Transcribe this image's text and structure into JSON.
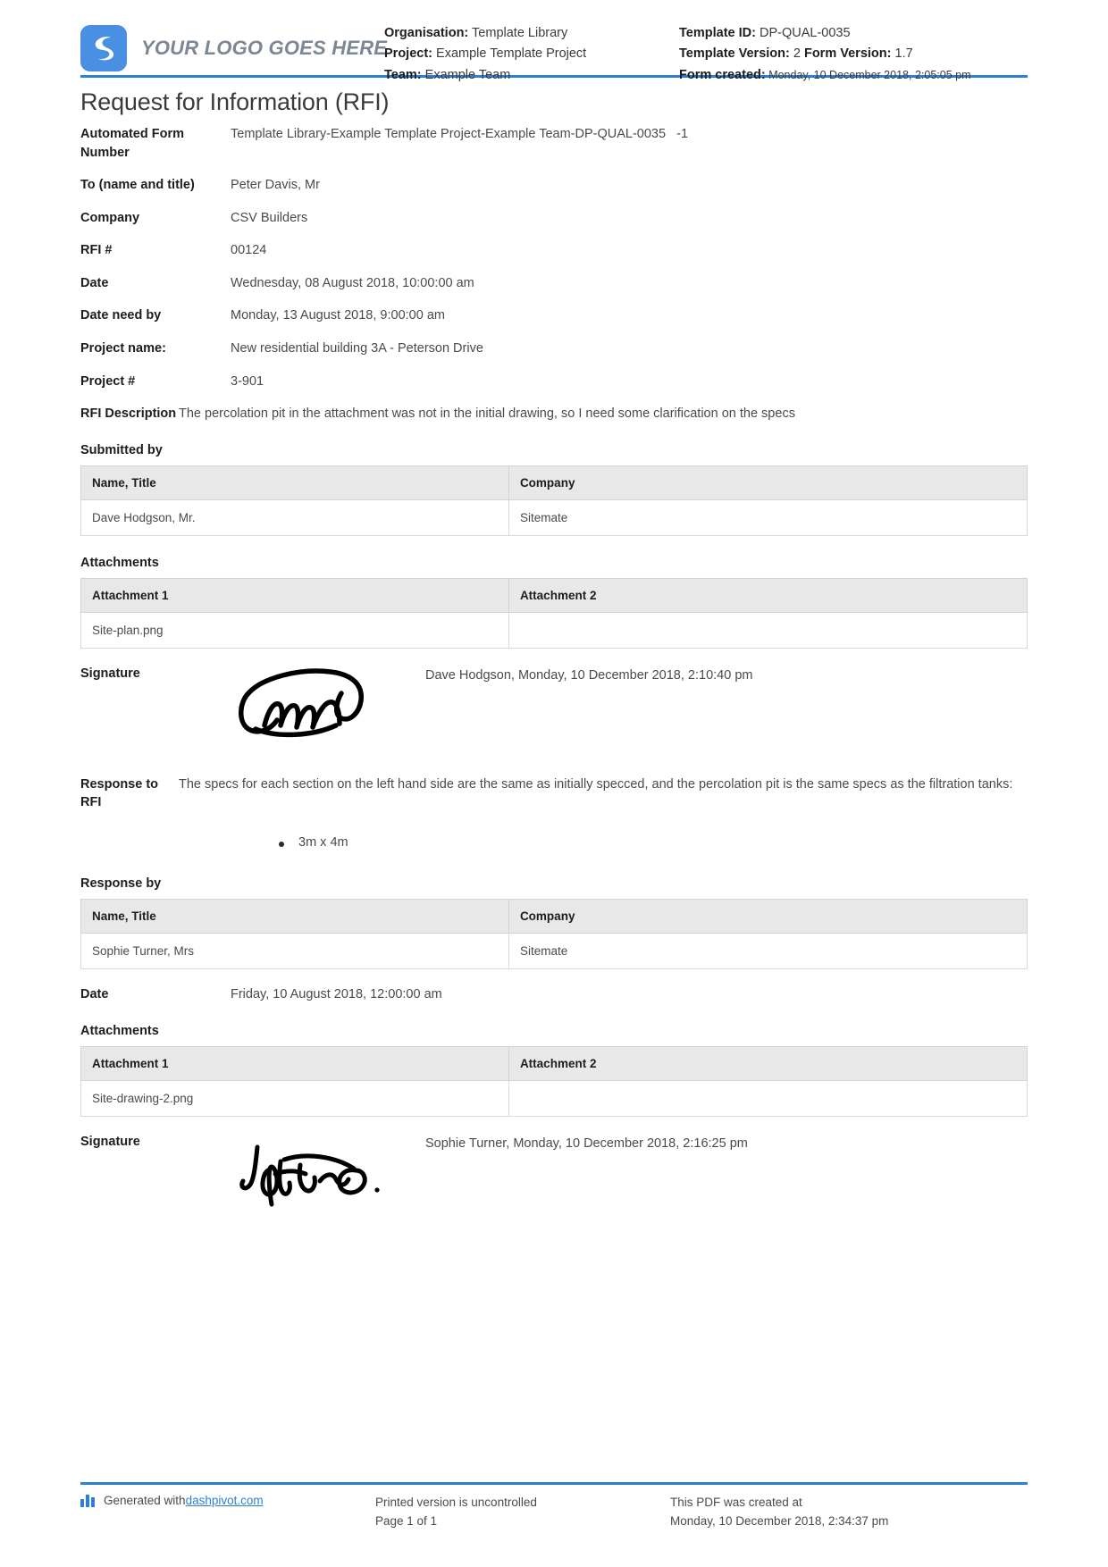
{
  "header": {
    "logo_text": "YOUR LOGO GOES HERE",
    "left": {
      "organisation_label": "Organisation:",
      "organisation_value": "Template Library",
      "project_label": "Project:",
      "project_value": "Example Template Project",
      "team_label": "Team:",
      "team_value": "Example Team"
    },
    "right": {
      "template_id_label": "Template ID:",
      "template_id_value": "DP-QUAL-0035",
      "template_version_label": "Template Version:",
      "template_version_value": "2",
      "form_version_label": "Form Version:",
      "form_version_value": "1.7",
      "form_created_label": "Form created:",
      "form_created_value": "Monday, 10 December 2018, 2:05:05 pm"
    }
  },
  "title": "Request for Information (RFI)",
  "fields": [
    {
      "label": "Automated Form Number",
      "value": "Template Library-Example Template Project-Example Team-DP-QUAL-0035   -1"
    },
    {
      "label": "To (name and title)",
      "value": "Peter Davis, Mr"
    },
    {
      "label": "Company",
      "value": "CSV Builders"
    },
    {
      "label": "RFI #",
      "value": "00124"
    },
    {
      "label": "Date",
      "value": "Wednesday, 08 August 2018, 10:00:00 am"
    },
    {
      "label": "Date need by",
      "value": "Monday, 13 August 2018, 9:00:00 am"
    },
    {
      "label": "Project name:",
      "value": "New residential building 3A - Peterson Drive"
    },
    {
      "label": "Project #",
      "value": "3-901"
    },
    {
      "label": "RFI Description",
      "value": "The percolation pit in the attachment was not in the initial drawing, so I need some clarification on the specs"
    }
  ],
  "submitted_by": {
    "heading": "Submitted by",
    "columns": [
      "Name, Title",
      "Company"
    ],
    "rows": [
      [
        "Dave Hodgson, Mr.",
        "Sitemate"
      ]
    ]
  },
  "attachments_1": {
    "heading": "Attachments",
    "columns": [
      "Attachment 1",
      "Attachment 2"
    ],
    "rows": [
      [
        "Site-plan.png",
        ""
      ]
    ]
  },
  "signature_1": {
    "label": "Signature",
    "meta": "Dave Hodgson, Monday, 10 December 2018, 2:10:40 pm"
  },
  "response": {
    "label": "Response to RFI",
    "value": "The specs for each section on the left hand side are the same as initially specced, and the percolation pit is the same specs as the filtration tanks:",
    "bullets": [
      "3m x 4m"
    ]
  },
  "response_by": {
    "heading": "Response by",
    "columns": [
      "Name, Title",
      "Company"
    ],
    "rows": [
      [
        "Sophie Turner, Mrs",
        "Sitemate"
      ]
    ]
  },
  "response_date": {
    "label": "Date",
    "value": "Friday, 10 August 2018, 12:00:00 am"
  },
  "attachments_2": {
    "heading": "Attachments",
    "columns": [
      "Attachment 1",
      "Attachment 2"
    ],
    "rows": [
      [
        "Site-drawing-2.png",
        ""
      ]
    ]
  },
  "signature_2": {
    "label": "Signature",
    "meta": "Sophie Turner, Monday, 10 December 2018, 2:16:25 pm"
  },
  "footer": {
    "generated_prefix": "Generated with ",
    "generated_link": "dashpivot.com",
    "uncontrolled": "Printed version is uncontrolled",
    "page_number": "Page 1 of 1",
    "created_at_label": "This PDF was created at",
    "created_at_value": "Monday, 10 December 2018, 2:34:37 pm"
  },
  "colors": {
    "accent": "#2f7fd1",
    "logo": "#4a90e2",
    "table_header": "#e8e8e8"
  }
}
